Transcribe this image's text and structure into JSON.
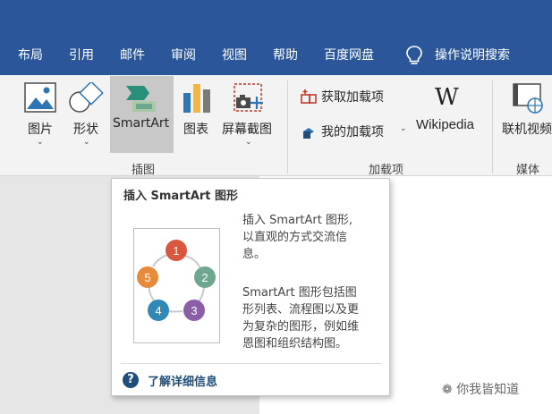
{
  "tabs": [
    {
      "label": "布局"
    },
    {
      "label": "引用"
    },
    {
      "label": "邮件"
    },
    {
      "label": "审阅"
    },
    {
      "label": "视图"
    },
    {
      "label": "帮助"
    },
    {
      "label": "百度网盘"
    }
  ],
  "tell_me": "操作说明搜索",
  "ribbon": {
    "illustrations": {
      "group_label": "插图",
      "pictures": "图片",
      "shapes": "形状",
      "smartart": "SmartArt",
      "chart": "图表",
      "screenshot": "屏幕截图"
    },
    "addins": {
      "group_label": "加载项",
      "get_addins": "获取加载项",
      "my_addins": "我的加载项",
      "wikipedia": "Wikipedia"
    },
    "media": {
      "group_label": "媒体",
      "online_video": "联机视频"
    }
  },
  "tooltip": {
    "title": "插入 SmartArt 图形",
    "desc1": [
      "插入 SmartArt 图形,",
      "以直观的方式交流信",
      "息。"
    ],
    "desc2": [
      "SmartArt 图形包括图",
      "形列表、流程图以及更",
      "为复杂的图形，例如维",
      "恩图和组织结构图。"
    ],
    "help_link": "了解详细信息",
    "diagram_numbers": [
      "1",
      "2",
      "3",
      "4",
      "5"
    ],
    "diagram_colors": [
      "#d9573f",
      "#6fa68f",
      "#8d5ea8",
      "#2f88b5",
      "#e78a3a"
    ]
  },
  "watermark": "你我皆知道"
}
